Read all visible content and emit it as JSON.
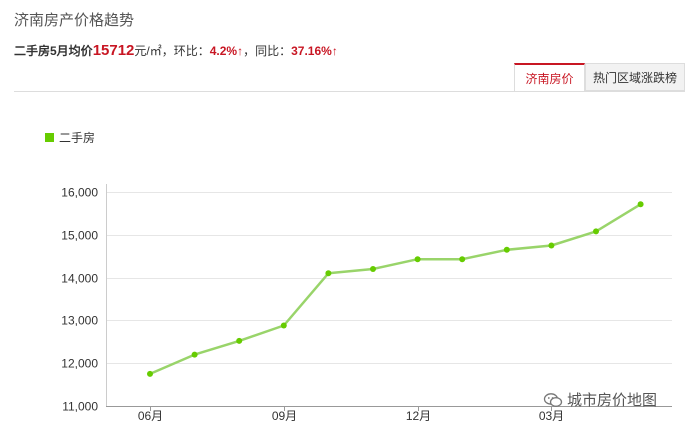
{
  "header": {
    "title": "济南房产价格趋势",
    "summary": {
      "label": "二手房5月均价",
      "price": "15712",
      "unit": "元/㎡，环比：",
      "mom": "4.2%",
      "arrow": "↑",
      "sep": "，同比：",
      "yoy": "37.16%"
    }
  },
  "tabs": [
    {
      "label": "济南房价",
      "active": true
    },
    {
      "label": "热门区域涨跌榜",
      "active": false
    }
  ],
  "watermark": {
    "text": "城市房价地图",
    "icon": "wechat-icon"
  },
  "colors": {
    "series": "#66cc00",
    "line": "#99d46a",
    "accent": "#c81623",
    "grid": "#e6e6e6"
  },
  "chart_data": {
    "type": "line",
    "x": [
      "06月",
      "07月",
      "08月",
      "09月",
      "10月",
      "11月",
      "12月",
      "01月",
      "02月",
      "03月",
      "04月",
      "05月"
    ],
    "tick_labels": [
      "06月",
      "09月",
      "12月",
      "03月"
    ],
    "tick_indices": [
      0,
      3,
      6,
      9
    ],
    "series": [
      {
        "name": "二手房",
        "values": [
          11750,
          12200,
          12520,
          12880,
          14100,
          14200,
          14430,
          14430,
          14650,
          14750,
          15080,
          15712
        ]
      }
    ],
    "ylim": [
      11000,
      16000
    ],
    "yticks": [
      11000,
      12000,
      13000,
      14000,
      15000,
      16000
    ],
    "ytick_labels": [
      "11,000",
      "12,000",
      "13,000",
      "14,000",
      "15,000",
      "16,000"
    ],
    "grid": true,
    "legend": "top-left"
  }
}
